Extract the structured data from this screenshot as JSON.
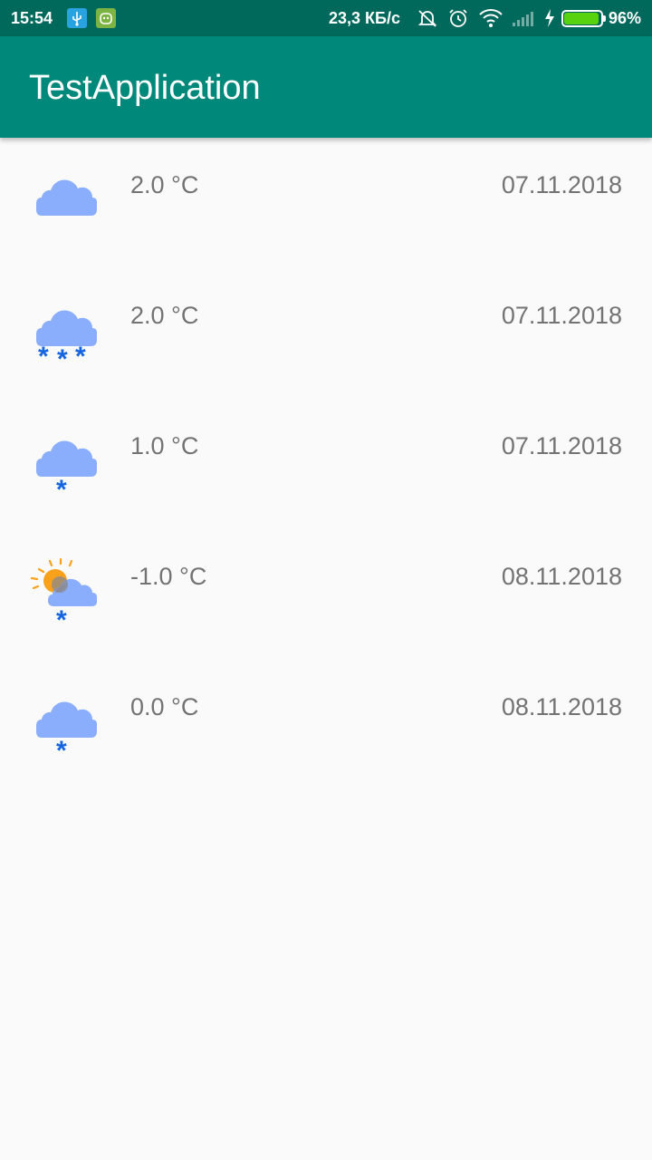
{
  "status_bar": {
    "time": "15:54",
    "network_speed": "23,3 КБ/с",
    "battery_percent": "96%",
    "battery_level": 0.96,
    "icons": [
      "usb-icon",
      "android-debug-icon",
      "mute-icon",
      "alarm-icon",
      "wifi-icon",
      "signal-icon",
      "charging-icon",
      "battery-icon"
    ]
  },
  "app_bar": {
    "title": "TestApplication"
  },
  "forecast": [
    {
      "icon": "cloud-icon",
      "temperature": "2.0 °C",
      "date": "07.11.2018"
    },
    {
      "icon": "cloud-heavy-snow-icon",
      "temperature": "2.0 °C",
      "date": "07.11.2018"
    },
    {
      "icon": "cloud-light-snow-icon",
      "temperature": "1.0 °C",
      "date": "07.11.2018"
    },
    {
      "icon": "sun-cloud-snow-icon",
      "temperature": "-1.0 °C",
      "date": "08.11.2018"
    },
    {
      "icon": "cloud-light-snow-icon",
      "temperature": "0.0 °C",
      "date": "08.11.2018"
    }
  ],
  "colors": {
    "status_bar": "#00695c",
    "app_bar": "#00897b",
    "cloud": "#8aaefc",
    "snow": "#1565e0",
    "sun": "#f9a11b",
    "text_secondary": "#737373"
  }
}
